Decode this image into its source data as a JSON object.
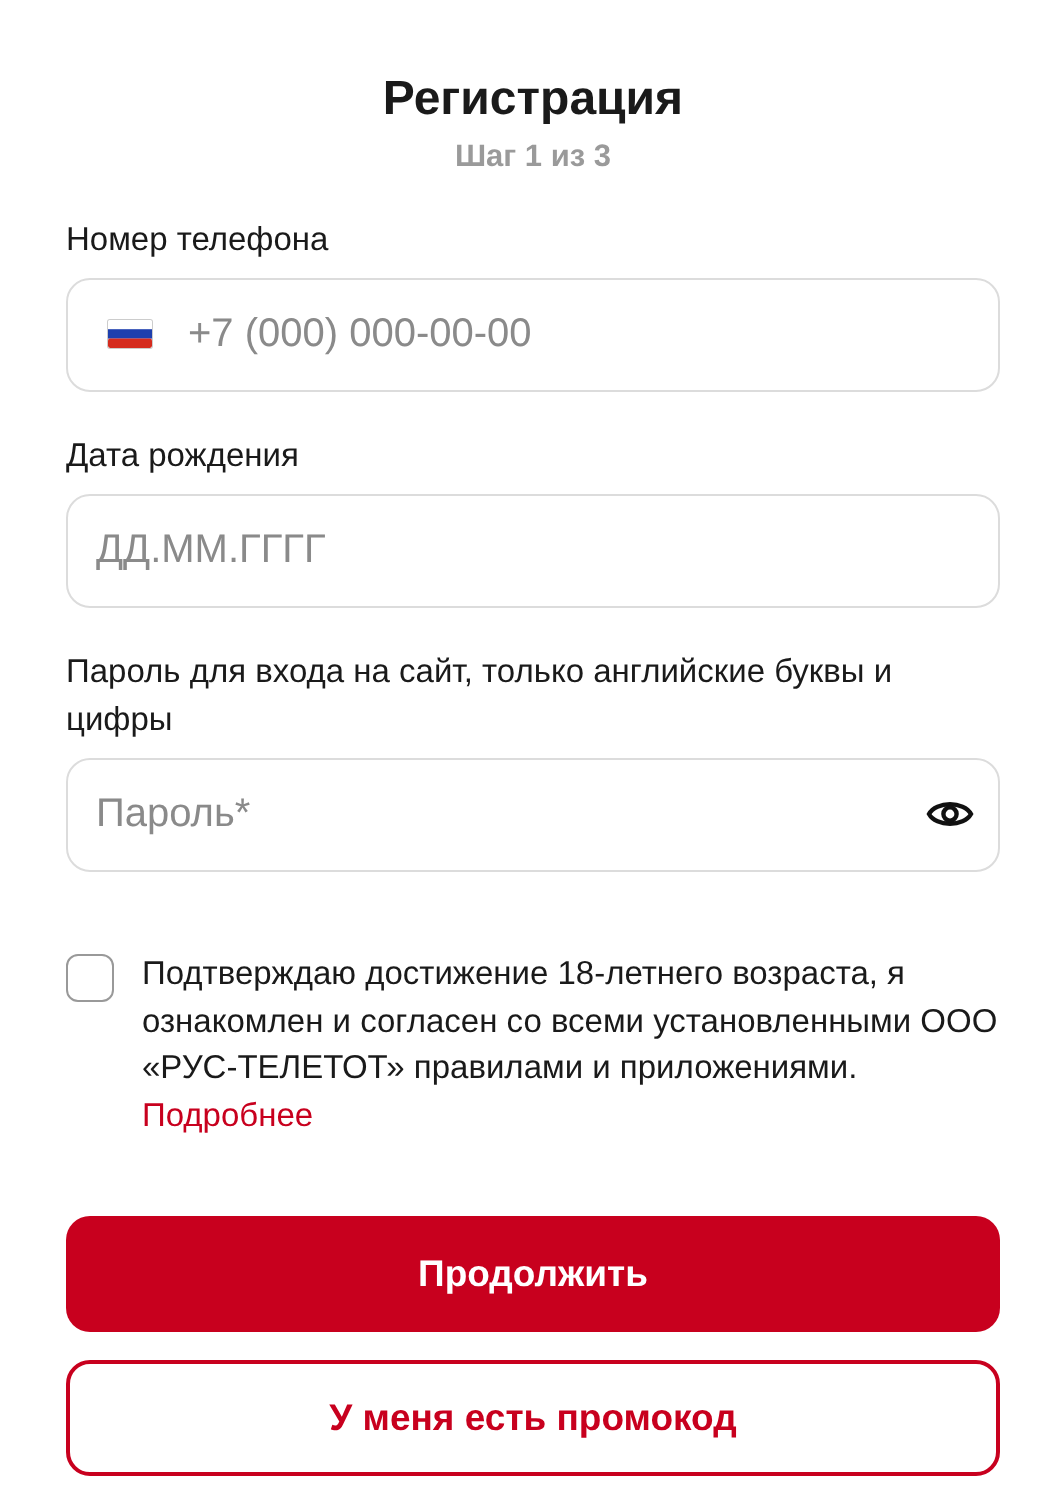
{
  "title": "Регистрация",
  "step": "Шаг 1 из 3",
  "fields": [
    {
      "kind": "phone",
      "label": "Номер телефона",
      "placeholder": "+7 (000) 000-00-00"
    },
    {
      "kind": "date",
      "label": "Дата рождения",
      "placeholder": "ДД.ММ.ГГГГ"
    },
    {
      "kind": "password",
      "label": "Пароль для входа на сайт, только английские буквы и цифры",
      "placeholder": "Пароль*"
    }
  ],
  "consent": {
    "checked": false,
    "text": "Подтверждаю достижение 18-летнего возраста, я ознакомлен и согласен со всеми установленными ООО «РУС-ТЕЛЕТОТ» правилами и приложениями.",
    "link": "Подробнее"
  },
  "buttons": [
    {
      "kind": "primary",
      "label": "Продолжить"
    },
    {
      "kind": "outline",
      "label": "У меня есть промокод"
    }
  ]
}
